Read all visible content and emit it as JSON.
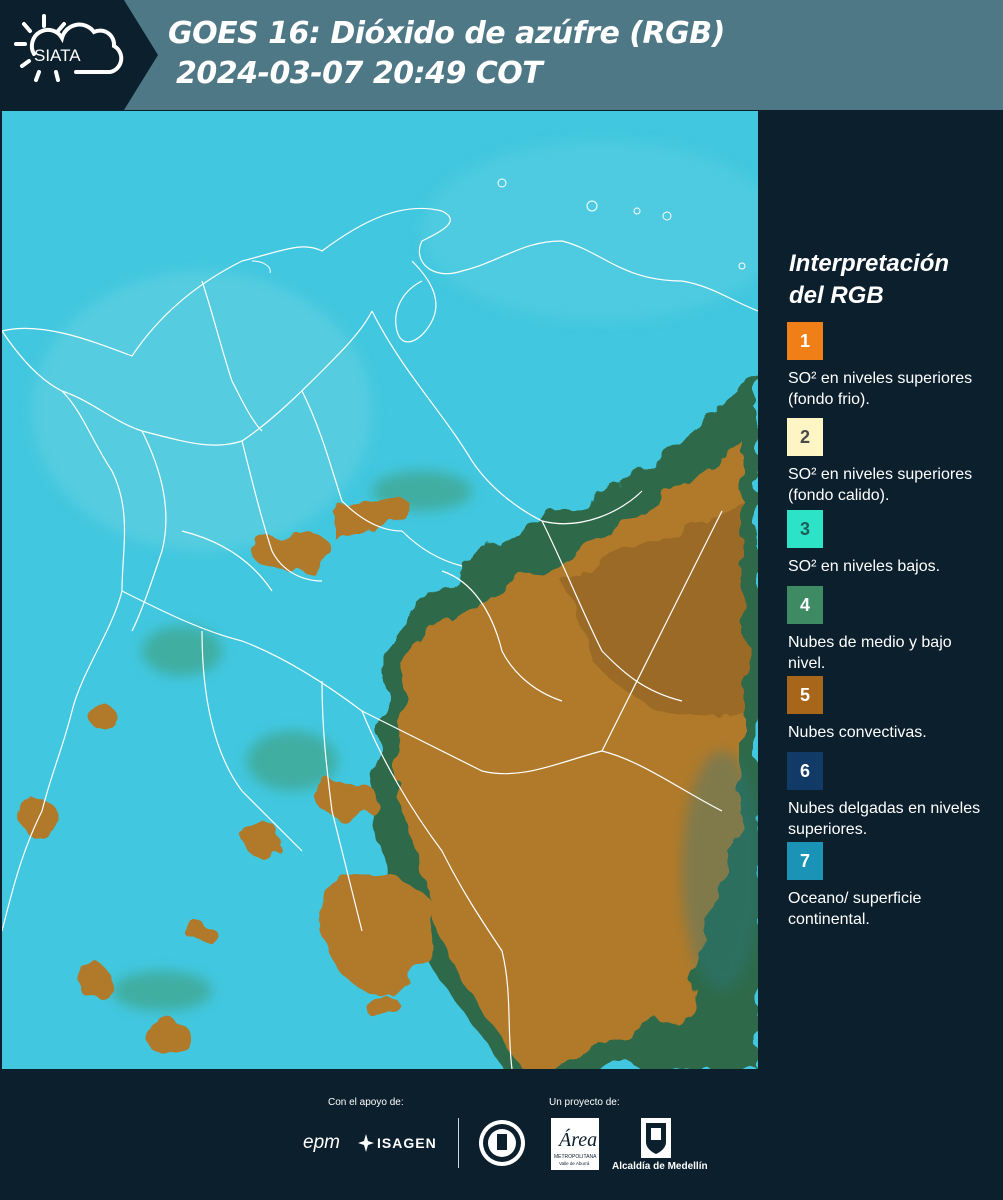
{
  "header": {
    "brand": "SIATA",
    "title_line1": "GOES 16: Dióxido de azúfre (RGB)",
    "title_line2": "2024-03-07 20:49 COT"
  },
  "legend": {
    "title_line1": "Interpretación",
    "title_line2": "del RGB",
    "items": [
      {
        "number": "1",
        "color": "#f07f18",
        "text_color": "#ffffff",
        "text": "SO² en niveles superiores (fondo frio)."
      },
      {
        "number": "2",
        "color": "#fdf6c4",
        "text_color": "#4a4a4a",
        "text": "SO² en niveles superiores (fondo calido)."
      },
      {
        "number": "3",
        "color": "#2de3c7",
        "text_color": "#1d5d5a",
        "text": "SO² en niveles bajos."
      },
      {
        "number": "4",
        "color": "#3e8a62",
        "text_color": "#ffffff",
        "text": "Nubes de medio y bajo nivel."
      },
      {
        "number": "5",
        "color": "#a8661a",
        "text_color": "#ffffff",
        "text": "Nubes convectivas."
      },
      {
        "number": "6",
        "color": "#123a66",
        "text_color": "#ffffff",
        "text": "Nubes delgadas en niveles superiores."
      },
      {
        "number": "7",
        "color": "#1b93b7",
        "text_color": "#ffffff",
        "text": "Oceano/ superficie continental."
      }
    ]
  },
  "footer": {
    "support_label": "Con el apoyo de:",
    "project_label": "Un proyecto de:",
    "epm": "epm",
    "isagen": "ISAGEN",
    "area_name": "Área",
    "area_sub": "METROPOLITANA",
    "area_sub2": "Valle de Aburrá",
    "alcaldia": "Alcaldía de Medellín"
  },
  "colors": {
    "header_bg": "#4f7886",
    "panel_bg": "#0c1f2c",
    "sea": "#41c7df",
    "land_cloud": "#b07a2c",
    "border_lines": "#ffffff"
  }
}
